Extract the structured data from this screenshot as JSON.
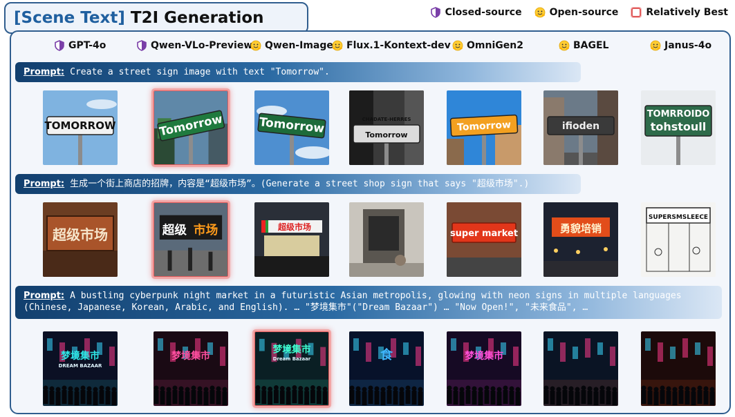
{
  "title": {
    "tag": "[Scene Text]",
    "text": "T2I Generation"
  },
  "legend": {
    "closed": "Closed-source",
    "open": "Open-source",
    "best": "Relatively Best"
  },
  "models": [
    {
      "name": "GPT-4o",
      "type": "closed"
    },
    {
      "name": "Qwen-VLo-Preview",
      "type": "closed"
    },
    {
      "name": "Qwen-Image",
      "type": "open"
    },
    {
      "name": "Flux.1-Kontext-dev",
      "type": "open"
    },
    {
      "name": "OmniGen2",
      "type": "open"
    },
    {
      "name": "BAGEL",
      "type": "open"
    },
    {
      "name": "Janus-4o",
      "type": "open"
    }
  ],
  "prompts": [
    {
      "label": "Prompt:",
      "text": "Create a street sign image with text \"Tomorrow\"."
    },
    {
      "label": "Prompt:",
      "text": "生成一个街上商店的招牌，内容是“超级市场”。(Generate a street shop sign that says \"超级市场\".)"
    },
    {
      "label": "Prompt:",
      "text": "A bustling cyberpunk night market in a futuristic Asian metropolis, glowing with neon signs in multiple languages (Chinese, Japanese, Korean, Arabic, and English). … \"梦境集市\"(\"Dream Bazaar\") … \"Now Open!\", \"未来食品\", …"
    }
  ],
  "rows": [
    {
      "best_index": 1,
      "images": [
        {
          "text": "TOMORROW"
        },
        {
          "text": "Tomorrow"
        },
        {
          "text": "Tomorrow"
        },
        {
          "text": "Tomorrow",
          "text2": "CHADATE-HERRES"
        },
        {
          "text": "Tomorrow"
        },
        {
          "text": "ifioden"
        },
        {
          "text": "tohstoull",
          "text2": "TOMRROIDO"
        }
      ]
    },
    {
      "best_index": 1,
      "images": [
        {
          "text": "超级市场"
        },
        {
          "text": "超级",
          "text2": "市场"
        },
        {
          "text": "超级市场"
        },
        {
          "text": ""
        },
        {
          "text": "super market"
        },
        {
          "text": "勇貌培销"
        },
        {
          "text": "SUPERSMSLEECE"
        }
      ]
    },
    {
      "best_index": 2,
      "images": [
        {
          "text": "梦境集市",
          "text2": "DREAM BAZAAR"
        },
        {
          "text": "梦境集市"
        },
        {
          "text": "梦境集市",
          "text2": "Dream Bazaar"
        },
        {
          "text": "食"
        },
        {
          "text": "梦境集市"
        },
        {
          "text": ""
        },
        {
          "text": ""
        }
      ]
    }
  ],
  "colors": {
    "frame": "#2f5d8e",
    "prompt_bar": "#1a4a7c",
    "best_glow": "#e05a5a"
  }
}
